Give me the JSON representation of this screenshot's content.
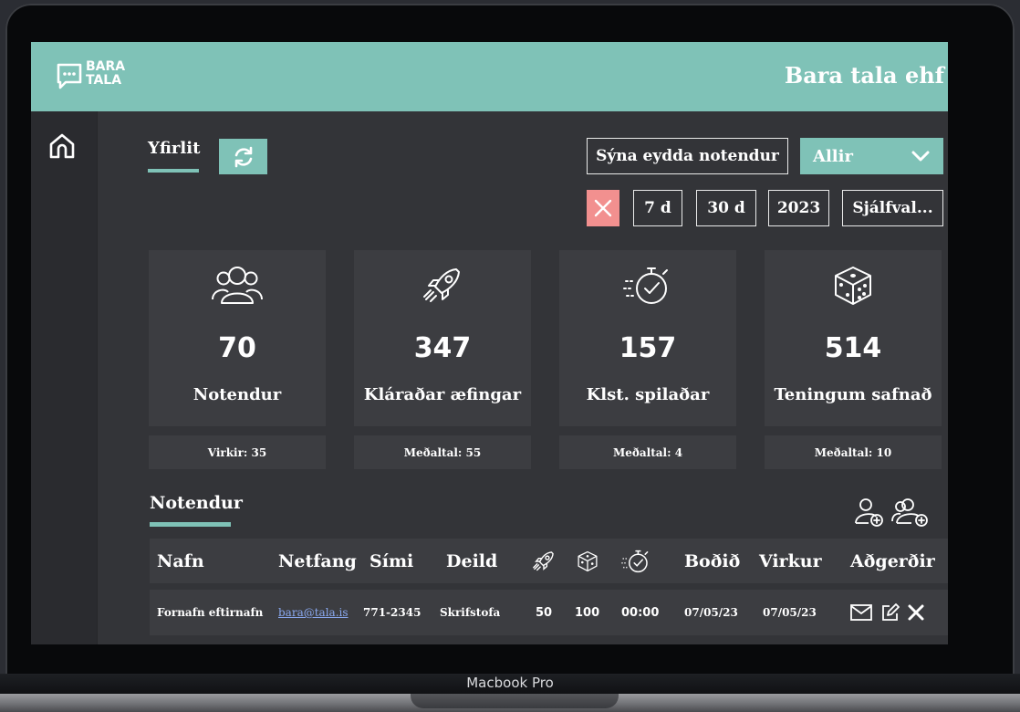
{
  "device": {
    "label": "Macbook Pro"
  },
  "header": {
    "logo_line1": "BARA",
    "logo_line2": "TALA",
    "company": "Bara tala ehf"
  },
  "toolbar": {
    "tab_overview": "Yfirlit",
    "show_deleted": "Sýna eydda notendur",
    "filter_selected": "Allir",
    "ranges": [
      "7 d",
      "30 d",
      "2023",
      "Sjálfval..."
    ]
  },
  "stats": [
    {
      "icon": "users-icon",
      "value": "70",
      "label": "Notendur",
      "sub": "Virkir: 35"
    },
    {
      "icon": "rocket-icon",
      "value": "347",
      "label": "Kláraðar æfingar",
      "sub": "Meðaltal: 55"
    },
    {
      "icon": "stopwatch-icon",
      "value": "157",
      "label": "Klst. spilaðar",
      "sub": "Meðaltal: 4"
    },
    {
      "icon": "dice-icon",
      "value": "514",
      "label": "Teningum safnað",
      "sub": "Meðaltal: 10"
    }
  ],
  "users": {
    "title": "Notendur",
    "columns": [
      "Nafn",
      "Netfang",
      "Sími",
      "Deild",
      "Boðið",
      "Virkur",
      "Aðgerðir"
    ],
    "rows": [
      {
        "name": "Fornafn eftirnafn",
        "email": "bara@tala.is",
        "phone": "771-2345",
        "department": "Skrifstofa",
        "exercises": "50",
        "dice": "100",
        "time": "00:00",
        "invited": "07/05/23",
        "active": "07/05/23"
      }
    ]
  },
  "colors": {
    "accent": "#7fc2b7",
    "danger": "#f2908f",
    "panel": "#3c3d41",
    "background": "#333438"
  }
}
